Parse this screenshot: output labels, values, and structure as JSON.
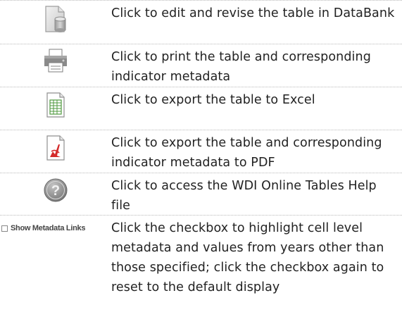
{
  "rows": [
    {
      "icon": "databank-edit-icon",
      "text": "Click to edit and revise the table in DataBank"
    },
    {
      "icon": "printer-icon",
      "text": "Click to print the table and corresponding indicator metadata"
    },
    {
      "icon": "excel-export-icon",
      "text": "Click to export the table to Excel"
    },
    {
      "icon": "pdf-export-icon",
      "text": "Click to export the table and corresponding indicator metadata to PDF"
    },
    {
      "icon": "help-icon",
      "text": "Click to access the WDI Online Tables Help file"
    },
    {
      "icon": "checkbox",
      "text": "Click the checkbox to highlight cell level metadata and values from years other than those specified; click the checkbox again to reset to the default display"
    }
  ],
  "metadata_checkbox": {
    "label": "Show Metadata Links",
    "checked": false
  },
  "colors": {
    "divider": "#b9b9b9",
    "text": "#222222",
    "pdf_red": "#d42a2a",
    "excel_green": "#4f9a3f",
    "icon_gray": "#8a8a8a"
  }
}
